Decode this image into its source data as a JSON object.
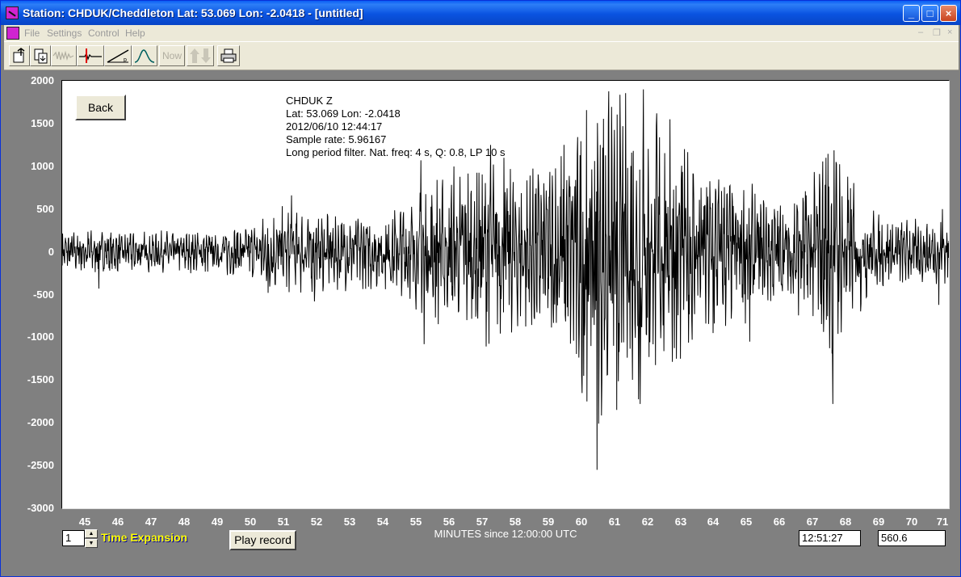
{
  "window": {
    "title": "Station: CHDUK/Cheddleton Lat: 53.069 Lon: -2.0418 - [untitled]",
    "buttons": {
      "minimize": "_",
      "maximize": "□",
      "close": "×"
    }
  },
  "menu": {
    "items": [
      "File",
      "Settings",
      "Control",
      "Help"
    ]
  },
  "toolbar": {
    "now_label": "Now",
    "icons": [
      "open-file-icon",
      "save-file-icon",
      "waveform-icon",
      "pick-marker-icon",
      "slope-icon",
      "filter-curve-icon",
      "now-icon",
      "up-down-arrows-icon",
      "printer-icon"
    ]
  },
  "buttons": {
    "back": "Back",
    "play_record": "Play record"
  },
  "info": {
    "station": "CHDUK  Z",
    "latlon": "Lat: 53.069 Lon: -2.0418",
    "datetime": "2012/06/10 12:44:17",
    "sample_rate": "Sample rate: 5.96167",
    "filter": "Long period filter. Nat. freq: 4 s, Q: 0.8, LP 10 s"
  },
  "controls": {
    "time_expansion_value": "1",
    "time_expansion_label": "Time Expansion",
    "time_readout": "12:51:27",
    "value_readout": "560.6"
  },
  "chart_data": {
    "type": "line",
    "title": "",
    "xlabel": "MINUTES since 12:00:00 UTC",
    "ylabel": "",
    "xlim": [
      44.4,
      71.1
    ],
    "ylim": [
      -3000,
      2000
    ],
    "yticks": [
      2000,
      1500,
      1000,
      500,
      0,
      -500,
      -1000,
      -1500,
      -2000,
      -2500,
      -3000
    ],
    "xticks": [
      45,
      46,
      47,
      48,
      49,
      50,
      51,
      52,
      53,
      54,
      55,
      56,
      57,
      58,
      59,
      60,
      61,
      62,
      63,
      64,
      65,
      66,
      67,
      68,
      69,
      70,
      71
    ],
    "grid": false,
    "series": [
      {
        "envelope": [
          [
            44.4,
            200
          ],
          [
            45,
            220
          ],
          [
            46,
            200
          ],
          [
            47,
            190
          ],
          [
            48,
            200
          ],
          [
            49,
            210
          ],
          [
            50,
            260
          ],
          [
            50.5,
            350
          ],
          [
            51,
            420
          ],
          [
            52,
            380
          ],
          [
            53,
            360
          ],
          [
            54,
            380
          ],
          [
            55,
            520
          ],
          [
            55.5,
            700
          ],
          [
            56,
            800
          ],
          [
            57,
            900
          ],
          [
            58,
            760
          ],
          [
            59,
            820
          ],
          [
            60,
            1300
          ],
          [
            60.5,
            1700
          ],
          [
            61,
            1400
          ],
          [
            61.8,
            1600
          ],
          [
            62,
            1500
          ],
          [
            62.5,
            1200
          ],
          [
            63,
            1050
          ],
          [
            64,
            800
          ],
          [
            65,
            650
          ],
          [
            66,
            500
          ],
          [
            67,
            700
          ],
          [
            67.6,
            1150
          ],
          [
            68,
            750
          ],
          [
            69,
            350
          ],
          [
            70,
            300
          ],
          [
            71,
            300
          ]
        ],
        "peaks": [
          [
            45.5,
            -430
          ],
          [
            50.6,
            -480
          ],
          [
            51.3,
            660
          ],
          [
            52,
            -580
          ],
          [
            55.2,
            1070
          ],
          [
            55.3,
            -1080
          ],
          [
            57.3,
            1250
          ],
          [
            57.7,
            1100
          ],
          [
            60.1,
            -1450
          ],
          [
            60.2,
            -1750
          ],
          [
            60.5,
            -2550
          ],
          [
            60.6,
            1250
          ],
          [
            61.1,
            -1850
          ],
          [
            61.6,
            1180
          ],
          [
            61.8,
            -1780
          ],
          [
            61.9,
            1900
          ],
          [
            62.7,
            1550
          ],
          [
            62.9,
            -1250
          ],
          [
            64.0,
            -950
          ],
          [
            65.1,
            -1050
          ],
          [
            67.4,
            1100
          ],
          [
            67.6,
            -1780
          ],
          [
            67.7,
            1050
          ],
          [
            70.8,
            -620
          ],
          [
            70.9,
            500
          ]
        ]
      }
    ]
  }
}
